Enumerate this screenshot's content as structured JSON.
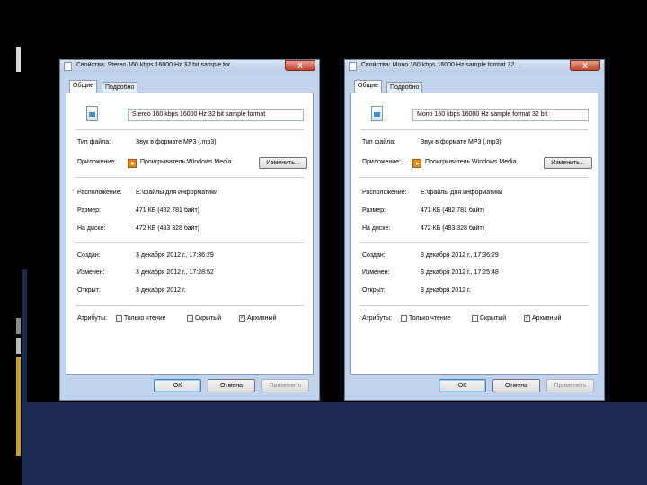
{
  "windows": [
    {
      "title": "Свойства: Stereo 160 kbps 16000 Hz 32 bit sample for…",
      "close_glyph": "X",
      "tabs": [
        "Общие",
        "Подробно"
      ],
      "file_name": "Stereo 160 kbps 16000 Hz 32 bit sample format",
      "file_type_label": "Тип файла:",
      "file_type_value": "Звук в формате MP3 (.mp3)",
      "app_label": "Приложение:",
      "app_name": "Проигрыватель Windows Media",
      "change_button": "Изменить...",
      "location_label": "Расположение:",
      "location_value": "E:\\файлы для информатики",
      "size_label": "Размер:",
      "size_value": "471 КБ (482 781 байт)",
      "disk_label": "На диске:",
      "disk_value": "472 КБ (483 328 байт)",
      "created_label": "Создан:",
      "created_value": "3 декабря 2012 г., 17:36:29",
      "modified_label": "Изменен:",
      "modified_value": "3 декабря 2012 г., 17:28:52",
      "opened_label": "Открыт:",
      "opened_value": "3 декабря 2012 г.",
      "attrs_label": "Атрибуты:",
      "attr_readonly": "Только чтение",
      "attr_hidden": "Скрытый",
      "attr_archive": "Архивный",
      "ok_button": "ОК",
      "cancel_button": "Отмена",
      "apply_button": "Применить"
    },
    {
      "title": "Свойства: Mono 160 kbps 16000 Hz sample format 32 …",
      "close_glyph": "X",
      "tabs": [
        "Общие",
        "Подробно"
      ],
      "file_name": "Mono 160 kbps 16000 Hz sample format 32 bit",
      "file_type_label": "Тип файла:",
      "file_type_value": "Звук в формате MP3 (.mp3)",
      "app_label": "Приложение:",
      "app_name": "Проигрыватель Windows Media",
      "change_button": "Изменить...",
      "location_label": "Расположение:",
      "location_value": "E:\\файлы для информатики",
      "size_label": "Размер:",
      "size_value": "471 КБ (482 781 байт)",
      "disk_label": "На диске:",
      "disk_value": "472 КБ (483 328 байт)",
      "created_label": "Создан:",
      "created_value": "3 декабря 2012 г., 17:36:29",
      "modified_label": "Изменен:",
      "modified_value": "3 декабря 2012 г., 17:25:48",
      "opened_label": "Открыт:",
      "opened_value": "3 декабря 2012 г.",
      "attrs_label": "Атрибуты:",
      "attr_readonly": "Только чтение",
      "attr_hidden": "Скрытый",
      "attr_archive": "Архивный",
      "ok_button": "ОК",
      "cancel_button": "Отмена",
      "apply_button": "Применить"
    }
  ],
  "attributes_checked": {
    "readonly": false,
    "hidden": false,
    "archive": true
  },
  "colors": {
    "window_frame": "#bfd4ec",
    "slide_accent": "#c8a02a",
    "slide_band": "#1a2a50"
  }
}
